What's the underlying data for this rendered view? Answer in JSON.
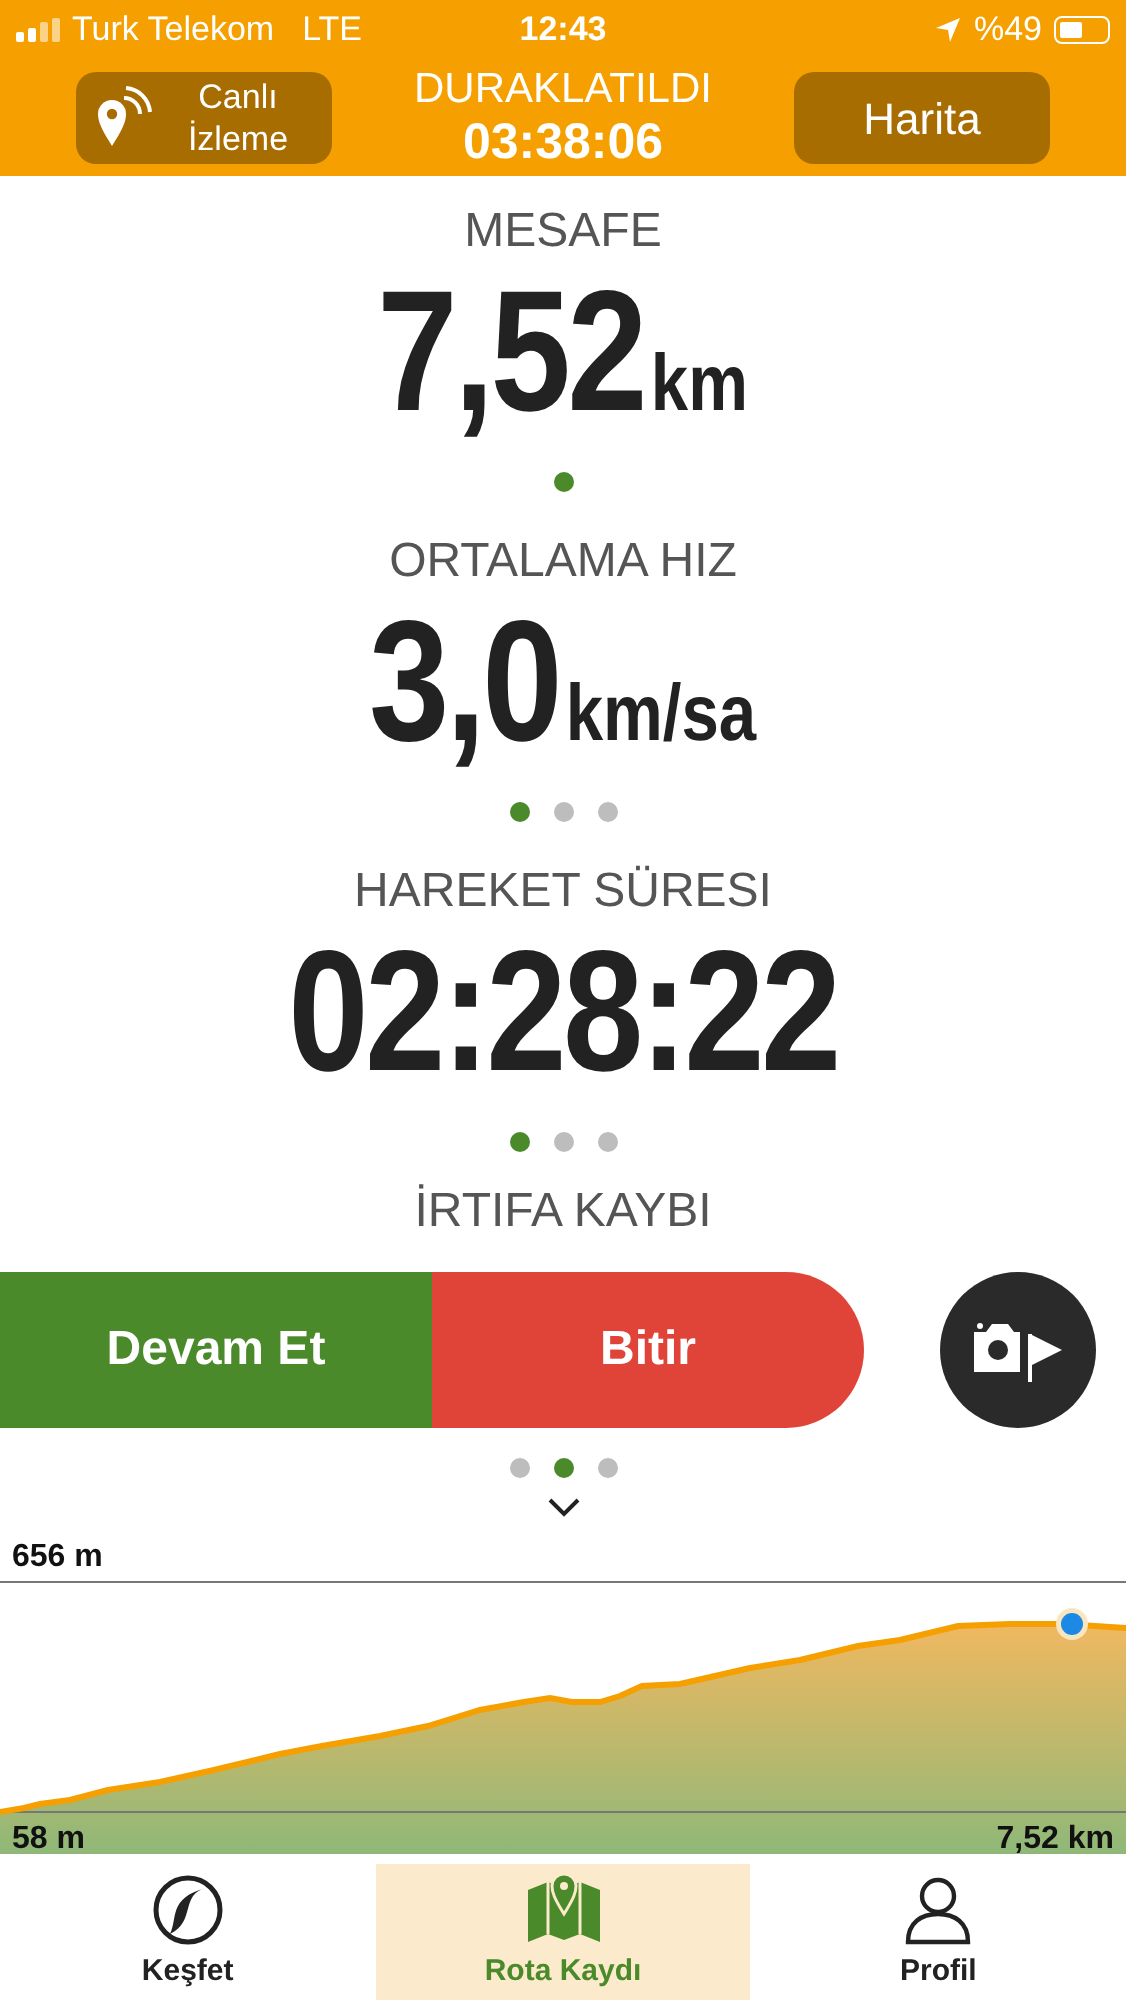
{
  "status_bar": {
    "carrier": "Turk Telekom",
    "network": "LTE",
    "time": "12:43",
    "battery": "%49"
  },
  "header": {
    "live_button": "Canlı İzleme",
    "state": "DURAKLATILDI",
    "elapsed": "03:38:06",
    "map_button": "Harita"
  },
  "metrics": [
    {
      "label": "MESAFE",
      "value": "7,52",
      "unit": "km",
      "pager": [
        {
          "selected": true
        }
      ]
    },
    {
      "label": "ORTALAMA HIZ",
      "value": "3,0",
      "unit": "km/sa",
      "pager": [
        {
          "selected": true
        },
        {
          "selected": false
        },
        {
          "selected": false
        }
      ]
    },
    {
      "label": "HAREKET SÜRESI",
      "value": "02:28:22",
      "pager": [
        {
          "selected": true
        },
        {
          "selected": false
        },
        {
          "selected": false
        }
      ]
    },
    {
      "label": "İRTIFA KAYBI",
      "pager": [
        {
          "selected": false
        },
        {
          "selected": true
        },
        {
          "selected": false
        }
      ]
    }
  ],
  "actions": {
    "resume": "Devam Et",
    "finish": "Bitir"
  },
  "elevation": {
    "max_label": "656 m",
    "min_label": "58 m",
    "distance_label": "7,52 km"
  },
  "tabs": [
    {
      "label": "Keşfet",
      "selected": false
    },
    {
      "label": "Rota Kaydı",
      "selected": true
    },
    {
      "label": "Profil",
      "selected": false
    }
  ]
}
